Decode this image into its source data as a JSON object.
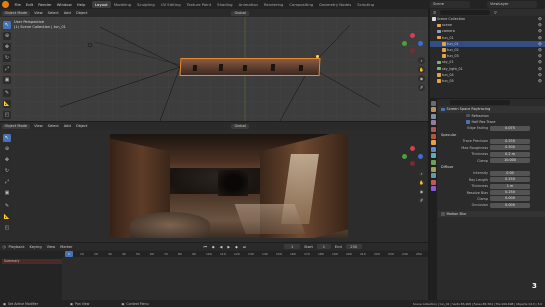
{
  "topbar": {
    "menus": [
      "File",
      "Edit",
      "Render",
      "Window",
      "Help"
    ],
    "workspaces": [
      "Layout",
      "Modeling",
      "Sculpting",
      "UV Editing",
      "Texture Paint",
      "Shading",
      "Animation",
      "Rendering",
      "Compositing",
      "Geometry Nodes",
      "Scripting"
    ],
    "scene_label": "Scene",
    "layer_label": "ViewLayer"
  },
  "viewport_top": {
    "mode": "Object Mode",
    "menus": [
      "View",
      "Select",
      "Add",
      "Object"
    ],
    "orientation": "Global",
    "info_line1": "User Perspective",
    "info_line2": "(1) Scene Collection | tun_01"
  },
  "viewport_bottom": {
    "mode": "Object Mode",
    "menus": [
      "View",
      "Select",
      "Add",
      "Object"
    ],
    "orientation": "Global"
  },
  "outliner": {
    "title": "Scene Collection",
    "items": [
      {
        "name": "Scene Collection",
        "indent": 0,
        "color": "#dcdcdc",
        "selected": false
      },
      {
        "name": "scene",
        "indent": 1,
        "color": "#e0a34a",
        "selected": false
      },
      {
        "name": "camera",
        "indent": 1,
        "color": "#8a9fc9",
        "selected": false
      },
      {
        "name": "tun_01",
        "indent": 1,
        "color": "#e0a34a",
        "selected": false
      },
      {
        "name": "tun_01",
        "indent": 2,
        "color": "#e0a34a",
        "selected": true
      },
      {
        "name": "tun_02",
        "indent": 2,
        "color": "#e0a34a",
        "selected": false
      },
      {
        "name": "tun_03",
        "indent": 2,
        "color": "#e0a34a",
        "selected": false
      },
      {
        "name": "sky_01",
        "indent": 1,
        "color": "#7db36b",
        "selected": false
      },
      {
        "name": "sky_light_01",
        "indent": 1,
        "color": "#7db36b",
        "selected": false
      },
      {
        "name": "tun_04",
        "indent": 1,
        "color": "#e0a34a",
        "selected": false
      },
      {
        "name": "tun_05",
        "indent": 1,
        "color": "#e0a34a",
        "selected": false
      }
    ]
  },
  "properties": {
    "search_placeholder": "",
    "ssr_label": "Screen Space Raytracing",
    "refraction_label": "Refraction",
    "halfres_label": "Half Res Trace",
    "edge_fading_label": "Edge Fading",
    "edge_fading": "0.075",
    "specular_header": "Specular",
    "specular": [
      {
        "label": "Trace Precision",
        "value": "0.250"
      },
      {
        "label": "Max Roughness",
        "value": "0.500"
      },
      {
        "label": "Thickness",
        "value": "0.2 m"
      },
      {
        "label": "Clamp",
        "value": "10.000"
      }
    ],
    "diffuse_header": "Diffuse",
    "diffuse": [
      {
        "label": "Intensity",
        "value": "0.00"
      },
      {
        "label": "Ray Length",
        "value": "0.250"
      },
      {
        "label": "Thickness",
        "value": "1 m"
      },
      {
        "label": "Resolve Bias",
        "value": "0.250"
      },
      {
        "label": "Clamp",
        "value": "0.000"
      },
      {
        "label": "Occlusion",
        "value": "0.000"
      }
    ],
    "motion_blur_label": "Motion Blur"
  },
  "timeline": {
    "menus": [
      "Playback",
      "Keying",
      "View",
      "Marker"
    ],
    "current_frame": "1",
    "start_label": "Start",
    "start": "1",
    "end_label": "End",
    "end": "250",
    "ticks": [
      "0",
      "10",
      "20",
      "30",
      "40",
      "50",
      "60",
      "70",
      "80",
      "90",
      "100",
      "110",
      "120",
      "130",
      "140",
      "150",
      "160",
      "170",
      "180",
      "190",
      "200",
      "210",
      "220",
      "230",
      "240",
      "250"
    ],
    "track_label": "Summary"
  },
  "status": {
    "left": "Set Active Modifier",
    "mid1": "Pan View",
    "mid2": "Context Menu",
    "right": "Scene Collection | tun_01 | Verts:83,468 | Faces:83,304 | Tris:166,608 | Objects:1/13 | 3.0"
  },
  "badge_number": "3",
  "colors": {
    "accent": "#4772b3",
    "logo": "#e87d0d",
    "selection": "#334d80"
  }
}
